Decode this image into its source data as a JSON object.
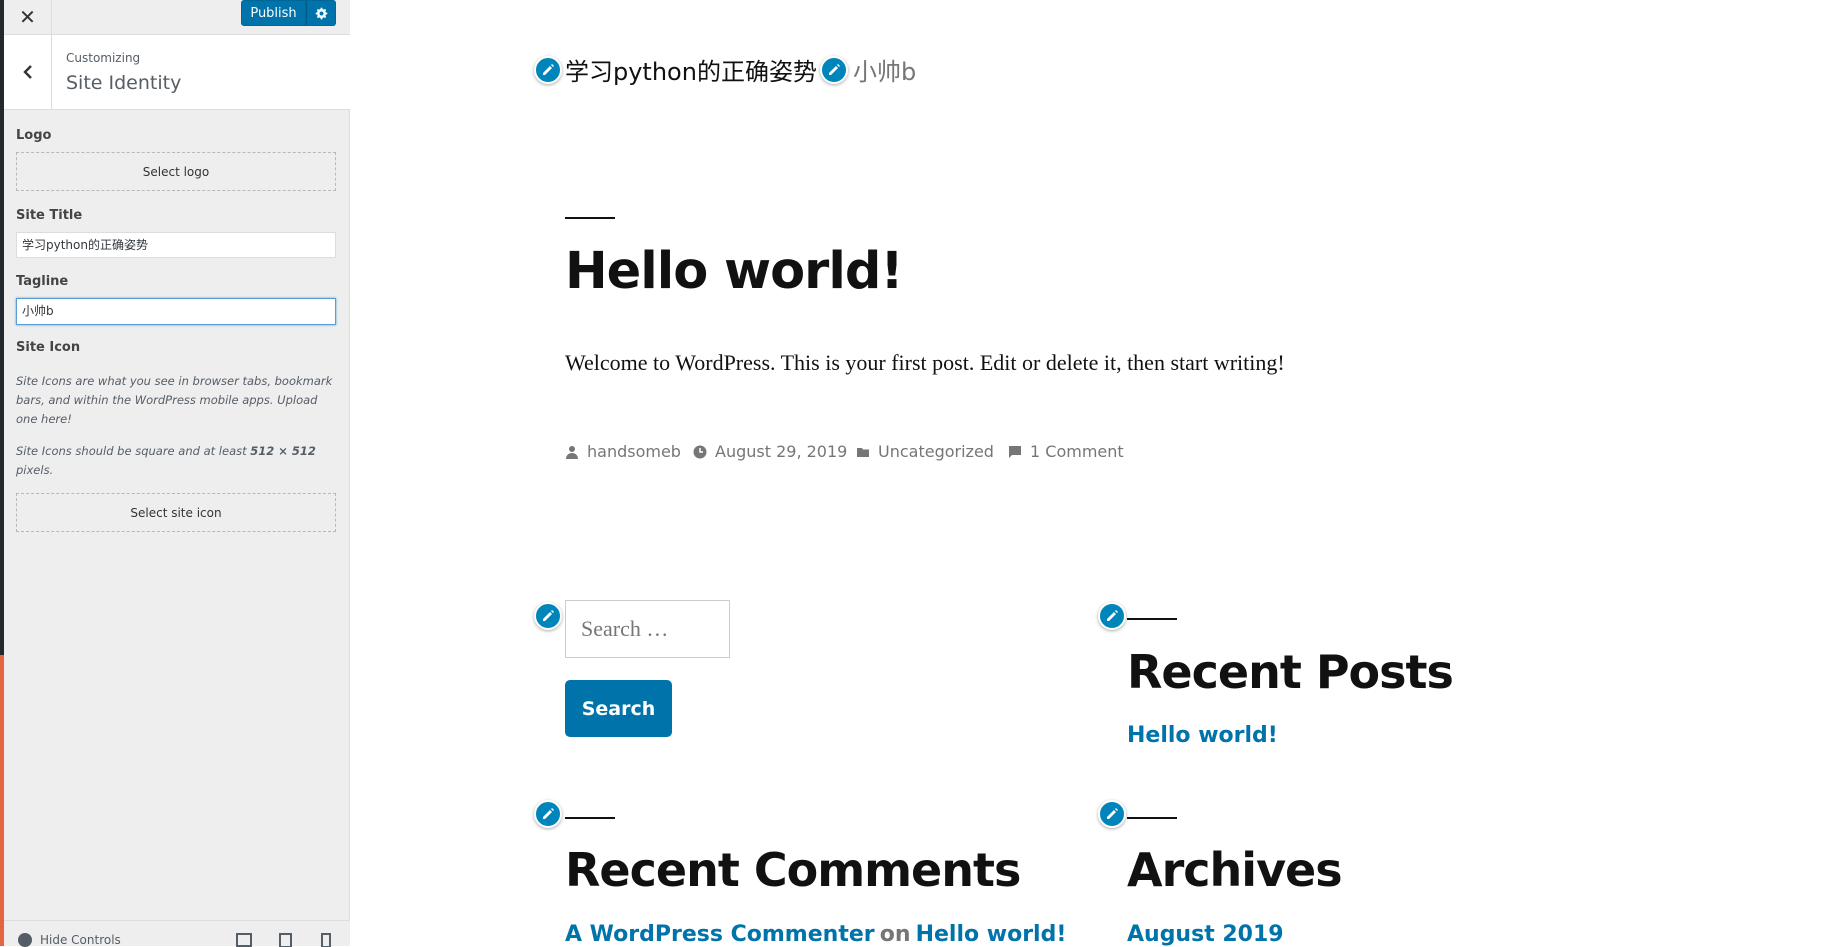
{
  "customizer": {
    "close_label": "✕",
    "publish_label": "Publish",
    "settings_icon": "gear-icon",
    "back_icon": "chevron-left-icon",
    "breadcrumb": "Customizing",
    "section_title": "Site Identity",
    "logo": {
      "label": "Logo",
      "button": "Select logo"
    },
    "site_title": {
      "label": "Site Title",
      "value": "学习python的正确姿势"
    },
    "tagline": {
      "label": "Tagline",
      "value": "小帅b"
    },
    "site_icon": {
      "label": "Site Icon",
      "desc1": "Site Icons are what you see in browser tabs, bookmark bars, and within the WordPress mobile apps. Upload one here!",
      "desc2_pre": "Site Icons should be square and at least ",
      "desc2_bold": "512 × 512",
      "desc2_post": " pixels.",
      "button": "Select site icon"
    },
    "footer": {
      "hide_controls": "Hide Controls"
    }
  },
  "preview": {
    "site_title": "学习python的正确姿势",
    "tagline": "小帅b",
    "post": {
      "title": "Hello world!",
      "body": "Welcome to WordPress. This is your first post. Edit or delete it, then start writing!",
      "author": "handsomeb",
      "date": "August 29, 2019",
      "category": "Uncategorized",
      "comments": "1 Comment"
    },
    "search": {
      "placeholder": "Search …",
      "button": "Search"
    },
    "recent_posts": {
      "title": "Recent Posts",
      "item": "Hello world!"
    },
    "recent_comments": {
      "title": "Recent Comments",
      "author": "A WordPress Commenter",
      "on": "on",
      "post": "Hello world!"
    },
    "archives": {
      "title": "Archives",
      "item": "August 2019"
    }
  },
  "colors": {
    "accent": "#0073aa",
    "panel_bg": "#eeeeee",
    "strip_orange": "#e4663e"
  }
}
